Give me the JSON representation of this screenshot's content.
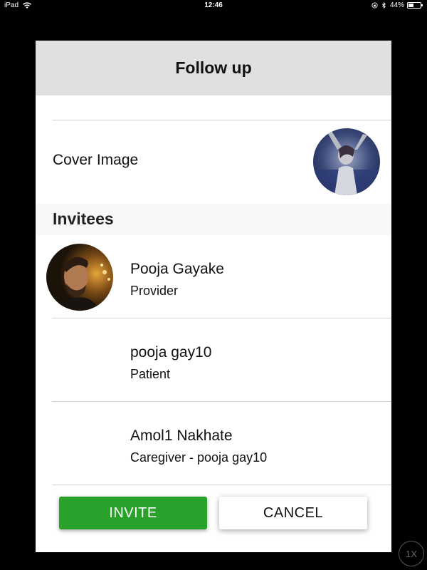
{
  "status_bar": {
    "device": "iPad",
    "time": "12:46",
    "battery_text": "44%",
    "battery_level": 0.44
  },
  "modal": {
    "title": "Follow up",
    "cover_image_label": "Cover Image",
    "invitees_title": "Invitees",
    "invitees": [
      {
        "name": "Pooja Gayake",
        "role": "Provider",
        "has_avatar": true
      },
      {
        "name": "pooja gay10",
        "role": "Patient",
        "has_avatar": false
      },
      {
        "name": "Amol1 Nakhate",
        "role": "Caregiver - pooja gay10",
        "has_avatar": false
      }
    ],
    "invite_label": "INVITE",
    "cancel_label": "CANCEL"
  },
  "zoom_badge": "1X",
  "colors": {
    "header_bg": "#dfe0df",
    "invite_button": "#2aa12a",
    "section_bg": "#f7f7f7",
    "divider": "#d4d4d4"
  },
  "icons": [
    "wifi-icon",
    "orientation-lock-icon",
    "bluetooth-icon",
    "battery-icon"
  ]
}
